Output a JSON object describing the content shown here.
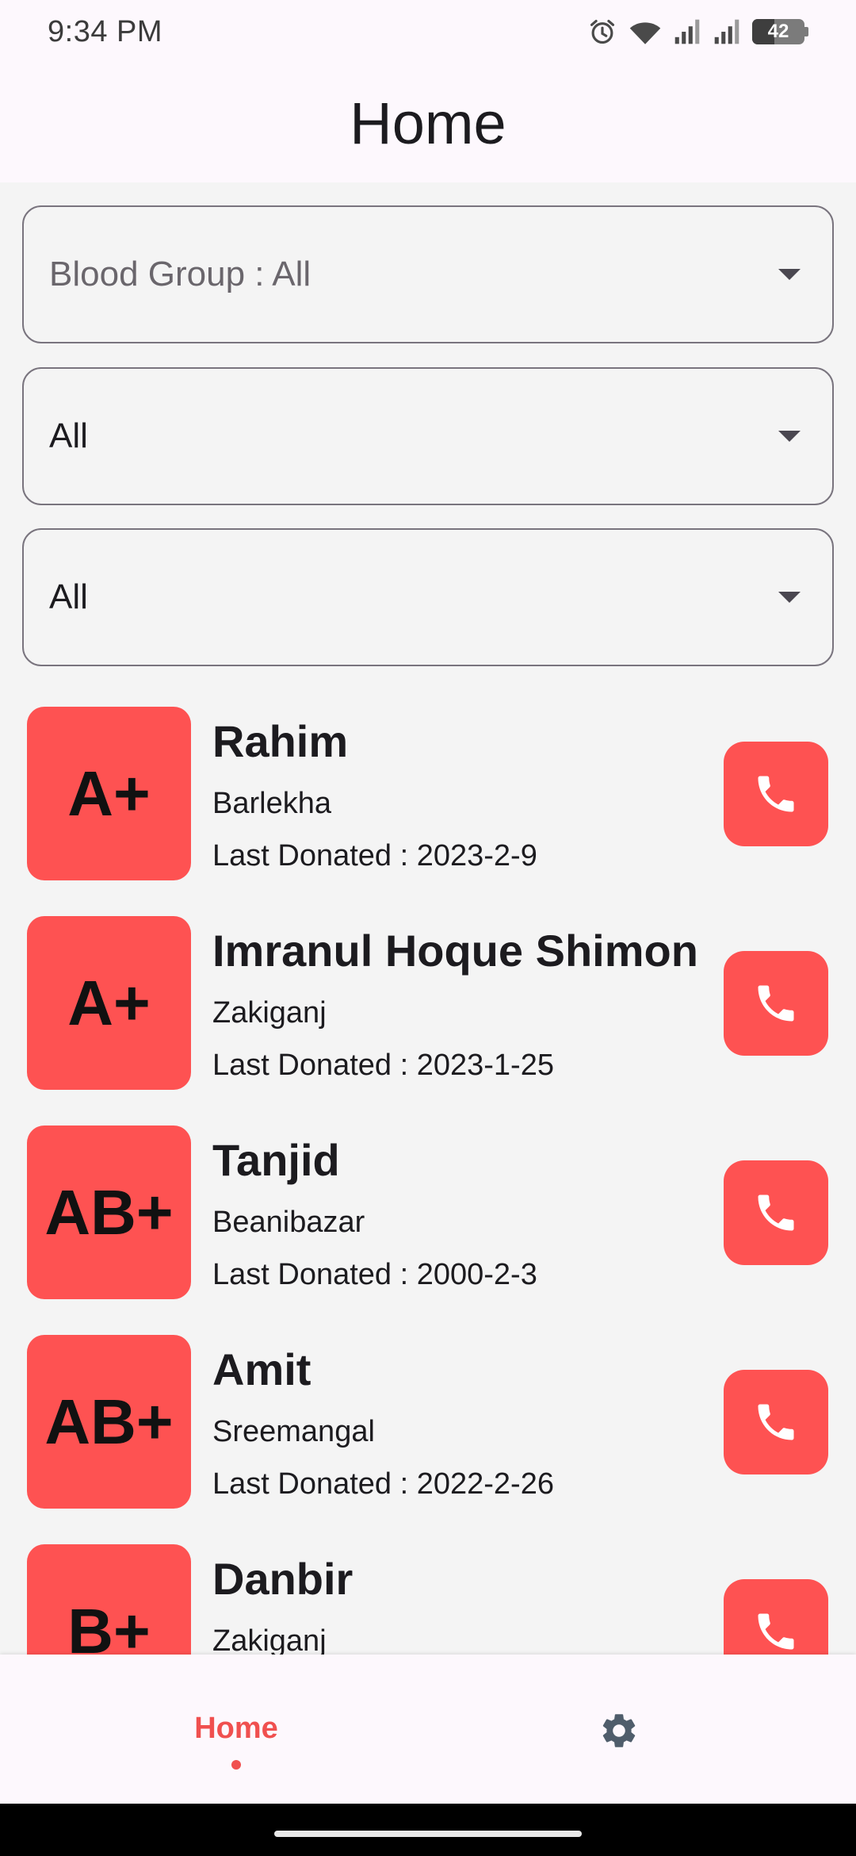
{
  "status_bar": {
    "time": "9:34 PM",
    "battery_level": "42",
    "icons": [
      "alarm-icon",
      "wifi-icon",
      "signal-icon",
      "signal-icon",
      "battery-icon"
    ]
  },
  "app_bar": {
    "title": "Home"
  },
  "filters": [
    {
      "text": "Blood Group : All",
      "placeholder": true
    },
    {
      "text": "All",
      "placeholder": false
    },
    {
      "text": "All",
      "placeholder": false
    }
  ],
  "donors": [
    {
      "group": "A+",
      "name": "Rahim",
      "place": "Barlekha",
      "last_donated": "Last Donated : 2023-2-9"
    },
    {
      "group": "A+",
      "name": "Imranul Hoque Shimon",
      "place": "Zakiganj",
      "last_donated": "Last Donated : 2023-1-25"
    },
    {
      "group": "AB+",
      "name": "Tanjid",
      "place": "Beanibazar",
      "last_donated": "Last Donated : 2000-2-3"
    },
    {
      "group": "AB+",
      "name": "Amit",
      "place": "Sreemangal",
      "last_donated": "Last Donated : 2022-2-26"
    },
    {
      "group": "B+",
      "name": "Danbir",
      "place": "Zakiganj",
      "last_donated": ""
    }
  ],
  "bottom_nav": {
    "home_label": "Home",
    "settings_icon": "gear-icon"
  },
  "colors": {
    "accent": "#fe5252",
    "nav_active": "#f0504f",
    "settings_icon": "#4f5d6b"
  }
}
